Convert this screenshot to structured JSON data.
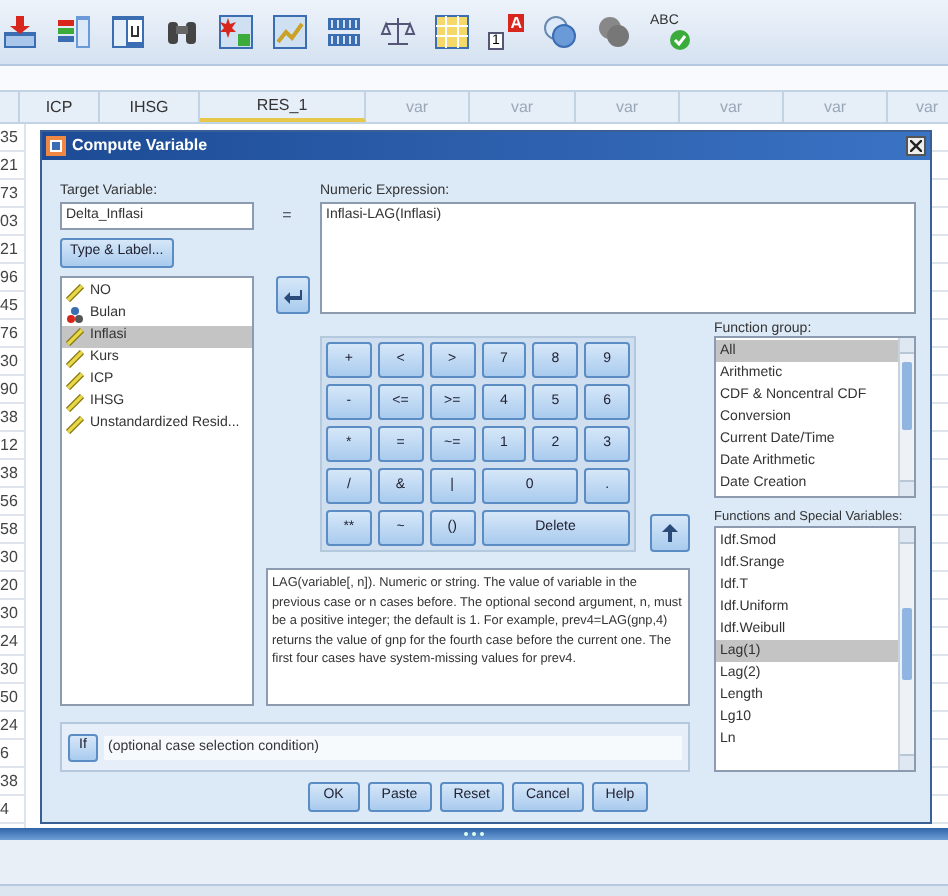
{
  "toolbar": [
    {
      "kind": "import"
    },
    {
      "kind": "variables"
    },
    {
      "kind": "goto"
    },
    {
      "kind": "find"
    },
    {
      "kind": "insert"
    },
    {
      "kind": "chart"
    },
    {
      "kind": "split"
    },
    {
      "kind": "weight"
    },
    {
      "kind": "select"
    },
    {
      "kind": "labels",
      "text": "A",
      "subtext": "1"
    },
    {
      "kind": "sets"
    },
    {
      "kind": "sets_gray"
    },
    {
      "kind": "spell",
      "text": "ABC"
    }
  ],
  "grid": {
    "columns": [
      {
        "label": "ICP",
        "defined": true,
        "selected": false
      },
      {
        "label": "IHSG",
        "defined": true,
        "selected": false
      },
      {
        "label": "RES_1",
        "defined": true,
        "selected": true
      },
      {
        "label": "var",
        "defined": false,
        "selected": false
      },
      {
        "label": "var",
        "defined": false,
        "selected": false
      },
      {
        "label": "var",
        "defined": false,
        "selected": false
      },
      {
        "label": "var",
        "defined": false,
        "selected": false
      },
      {
        "label": "var",
        "defined": false,
        "selected": false
      },
      {
        "label": "var",
        "defined": false,
        "selected": false
      }
    ],
    "row_values": [
      "35",
      "21",
      "73",
      "03",
      "21",
      "96",
      "45",
      "76",
      "30",
      "90",
      "38",
      "12",
      "38",
      "56",
      "58",
      "30",
      "20",
      "30",
      "24",
      "30",
      "50",
      "24",
      "6",
      "38",
      "4"
    ]
  },
  "dialog": {
    "title": "Compute Variable",
    "target_label": "Target Variable:",
    "target_value": "Delta_Inflasi",
    "equals": "=",
    "type_label_button": "Type & Label...",
    "expression_label": "Numeric Expression:",
    "expression": "Inflasi-LAG(Inflasi)",
    "variables": [
      {
        "name": "NO",
        "kind": "scale",
        "selected": false
      },
      {
        "name": "Bulan",
        "kind": "nominal",
        "selected": false
      },
      {
        "name": "Inflasi",
        "kind": "scale",
        "selected": true
      },
      {
        "name": "Kurs",
        "kind": "scale",
        "selected": false
      },
      {
        "name": "ICP",
        "kind": "scale",
        "selected": false
      },
      {
        "name": "IHSG",
        "kind": "scale",
        "selected": false
      },
      {
        "name": "Unstandardized Resid...",
        "kind": "scale",
        "selected": false
      }
    ],
    "keypad": [
      {
        "label": "+",
        "kind": "key"
      },
      {
        "label": "<",
        "kind": "key"
      },
      {
        "label": ">",
        "kind": "key"
      },
      {
        "label": "7",
        "kind": "key"
      },
      {
        "label": "8",
        "kind": "key"
      },
      {
        "label": "9",
        "kind": "key"
      },
      {
        "label": "-",
        "kind": "key"
      },
      {
        "label": "<=",
        "kind": "key"
      },
      {
        "label": ">=",
        "kind": "key"
      },
      {
        "label": "4",
        "kind": "key"
      },
      {
        "label": "5",
        "kind": "key"
      },
      {
        "label": "6",
        "kind": "key"
      },
      {
        "label": "*",
        "kind": "key"
      },
      {
        "label": "=",
        "kind": "key"
      },
      {
        "label": "~=",
        "kind": "key"
      },
      {
        "label": "1",
        "kind": "key"
      },
      {
        "label": "2",
        "kind": "key"
      },
      {
        "label": "3",
        "kind": "key"
      },
      {
        "label": "/",
        "kind": "key"
      },
      {
        "label": "&",
        "kind": "key"
      },
      {
        "label": "|",
        "kind": "key"
      },
      {
        "label": "0",
        "kind": "double"
      },
      {
        "label": ".",
        "kind": "key"
      },
      {
        "label": "**",
        "kind": "key"
      },
      {
        "label": "~",
        "kind": "key"
      },
      {
        "label": "()",
        "kind": "key"
      },
      {
        "label": "Delete",
        "kind": "triple"
      }
    ],
    "function_group_label": "Function group:",
    "function_groups": [
      {
        "label": "All",
        "selected": true
      },
      {
        "label": "Arithmetic",
        "selected": false
      },
      {
        "label": "CDF & Noncentral CDF",
        "selected": false
      },
      {
        "label": "Conversion",
        "selected": false
      },
      {
        "label": "Current Date/Time",
        "selected": false
      },
      {
        "label": "Date Arithmetic",
        "selected": false
      },
      {
        "label": "Date Creation",
        "selected": false
      }
    ],
    "functions_label": "Functions and Special Variables:",
    "functions": [
      {
        "label": "Idf.Smod",
        "selected": false
      },
      {
        "label": "Idf.Srange",
        "selected": false
      },
      {
        "label": "Idf.T",
        "selected": false
      },
      {
        "label": "Idf.Uniform",
        "selected": false
      },
      {
        "label": "Idf.Weibull",
        "selected": false
      },
      {
        "label": "Lag(1)",
        "selected": true
      },
      {
        "label": "Lag(2)",
        "selected": false
      },
      {
        "label": "Length",
        "selected": false
      },
      {
        "label": "Lg10",
        "selected": false
      },
      {
        "label": "Ln",
        "selected": false
      }
    ],
    "description": "LAG(variable[, n]). Numeric or string. The value of variable in the previous case or n cases before. The optional second argument, n, must be a positive integer; the default is 1. For example, prev4=LAG(gnp,4) returns the value of gnp for the fourth case before the current one. The first four cases have system-missing values for prev4.",
    "if_button": "If",
    "if_condition": "(optional case selection condition)",
    "buttons": [
      "OK",
      "Paste",
      "Reset",
      "Cancel",
      "Help"
    ]
  }
}
